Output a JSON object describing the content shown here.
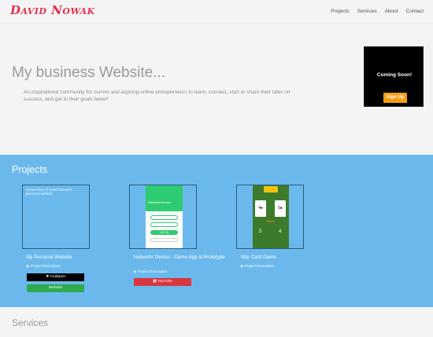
{
  "header": {
    "brand": "David Nowak",
    "nav": [
      "Projects",
      "Services",
      "About",
      "Contact"
    ]
  },
  "hero": {
    "title": "My business Website...",
    "description": "An inspirational community for current and aspiring online entrepreneurs to learn, connect, start or share their tales on success, and get to their goals faster!",
    "card_text": "Coming Soon!",
    "signup_label": "Sign Up"
  },
  "projects": {
    "title": "Projects",
    "items": [
      {
        "image_alt": "Screenshot of David Nowak's personal website",
        "title": "My Personal Website",
        "description": "Project Description",
        "buttons": [
          {
            "label": "Codepen",
            "icon": "codepen-icon",
            "color": "#000000"
          },
          {
            "label": "Website",
            "color": "#2eaa4c"
          }
        ]
      },
      {
        "title": "Networkr Genius - Demo App of Prototype",
        "description": "Project Description",
        "app_logo": "NetworkrGenius",
        "app_login": "LOG IN",
        "buttons": [
          {
            "label": "YouTube",
            "icon": "youtube-icon",
            "color": "#d9363e"
          }
        ]
      },
      {
        "title": "War Card Game",
        "description": "Project Description",
        "game_word": "WAR!",
        "cards": [
          "4♠",
          "6♠"
        ],
        "scores": [
          "5",
          "4"
        ]
      }
    ]
  },
  "services": {
    "title": "Services"
  },
  "colors": {
    "brand": "#e0304e",
    "projects_bg": "#6bb9ec",
    "signup": "#f39c12"
  }
}
